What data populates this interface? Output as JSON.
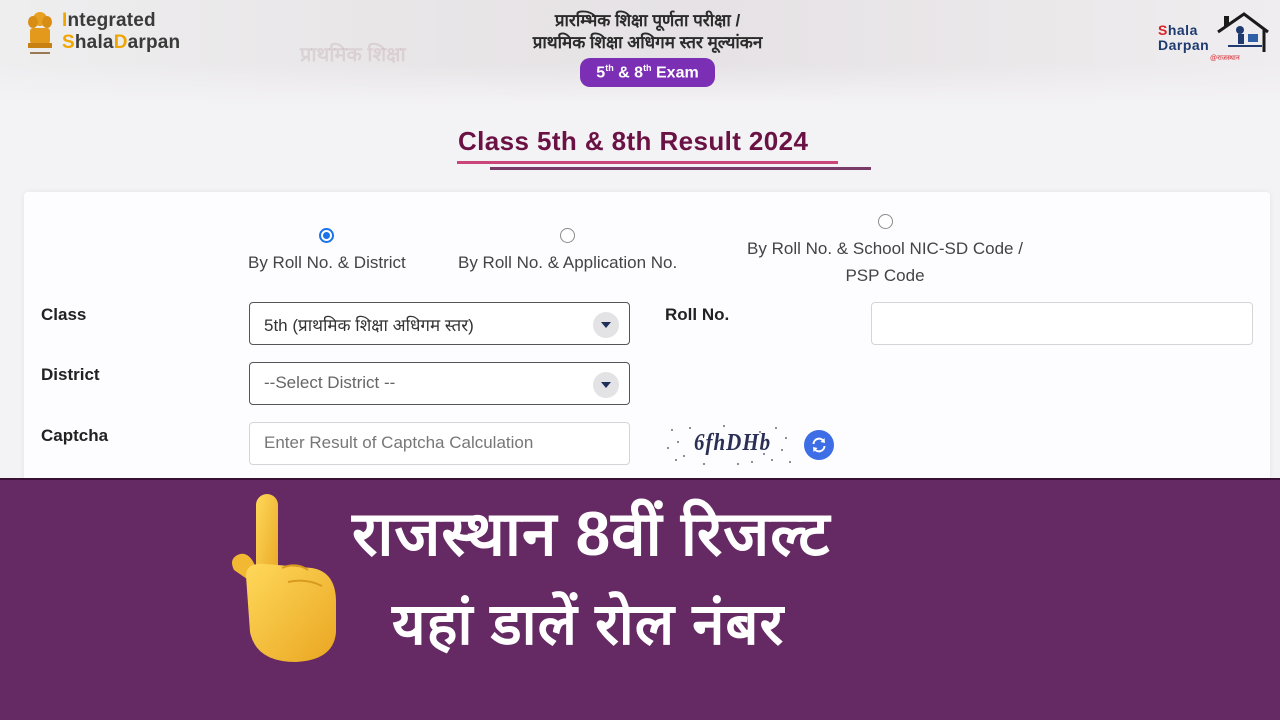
{
  "header": {
    "left_logo": {
      "line1_highlight": "I",
      "line1_rest": "ntegrated",
      "line2_highlight1": "S",
      "line2_mid": "hala",
      "line2_highlight2": "D",
      "line2_rest": "arpan"
    },
    "hindi_line1": "प्रारम्भिक शिक्षा पूर्णता परीक्षा /",
    "hindi_line2": "प्राथमिक शिक्षा अधिगम स्तर मूल्यांकन",
    "exam_badge": {
      "n1": "5",
      "sup1": "th",
      "amp": " & ",
      "n2": "8",
      "sup2": "th",
      "label": " Exam"
    },
    "right_logo": {
      "s_red": "S",
      "line1_rest": "hala",
      "line2": "Darpan",
      "tagline": "@राजस्थान"
    },
    "background_ghost_text": "प्राथमिक शिक्षा"
  },
  "page": {
    "title": "Class 5th & 8th Result 2024"
  },
  "form": {
    "search_modes": [
      {
        "label": "By Roll No. & District",
        "selected": true
      },
      {
        "label": "By Roll No. & Application No.",
        "selected": false
      },
      {
        "label_line1": "By Roll No. & School NIC-SD Code /",
        "label_line2": "PSP Code",
        "selected": false
      }
    ],
    "class_label": "Class",
    "class_value": "5th (प्राथमिक शिक्षा अधिगम स्तर)",
    "district_label": "District",
    "district_value": "--Select District --",
    "roll_label": "Roll No.",
    "roll_value": "",
    "captcha_label": "Captcha",
    "captcha_placeholder": "Enter Result of Captcha Calculation",
    "captcha_text": "6fhDHb",
    "refresh_icon": "refresh-icon"
  },
  "banner": {
    "line1": "राजस्थान 8वीं रिजल्ट",
    "line2": "यहां डालें रोल नंबर",
    "icon": "pointing-up-hand-emoji"
  },
  "colors": {
    "banner_bg": "#652a63",
    "title_color": "#6a1244",
    "badge_bg": "#7b2fb5",
    "radio_selected": "#1a73e8",
    "refresh_bg": "#3e6ee6",
    "logo_accent": "#f0a500"
  }
}
